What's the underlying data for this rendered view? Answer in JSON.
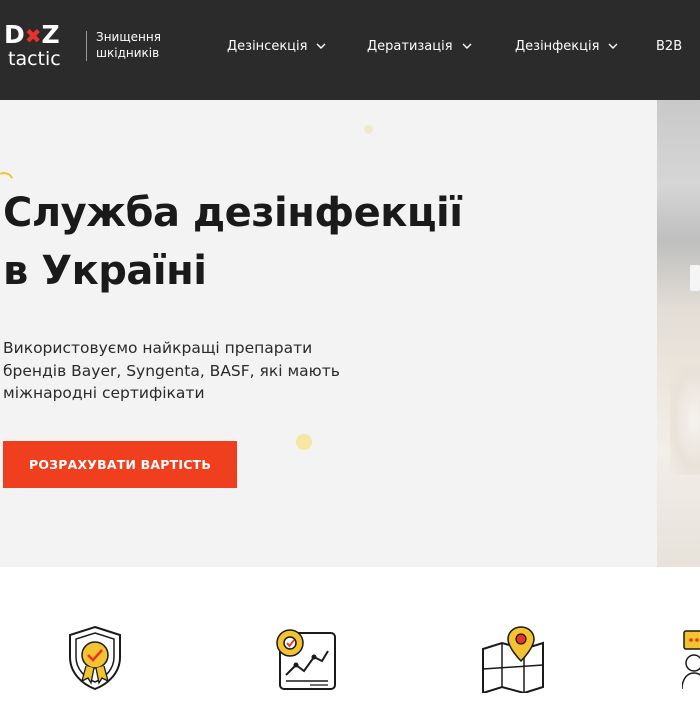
{
  "header": {
    "logo": {
      "brand_top": "DZ",
      "brand_bottom": "tactic"
    },
    "tagline_line1": "Знищення",
    "tagline_line2": "шкідників",
    "nav": [
      {
        "label": "Дезінсекція",
        "has_dropdown": true
      },
      {
        "label": "Дератизація",
        "has_dropdown": true
      },
      {
        "label": "Дезінфекція",
        "has_dropdown": true
      },
      {
        "label": "B2B",
        "has_dropdown": false
      }
    ]
  },
  "hero": {
    "title_line1": "Служба дезінфекції",
    "title_line2": "в Україні",
    "subtitle_line1": "Використовуємо найкращі препарати",
    "subtitle_line2": "брендів Bayer, Syngenta, BASF, які мають",
    "subtitle_line3": "міжнародні сертифікати",
    "cta_label": "РОЗРАХУВАТИ ВАРТІСТЬ"
  },
  "features": {
    "icons": [
      "shield-certified-icon",
      "gear-growth-chart-icon",
      "map-location-pin-icon",
      "support-agent-chat-icon"
    ]
  },
  "colors": {
    "header_bg": "#2b2b2b",
    "hero_bg": "#f3f3f3",
    "accent": "#ef3f1f",
    "icon_yellow": "#f4c430",
    "logo_red": "#e8322c"
  }
}
